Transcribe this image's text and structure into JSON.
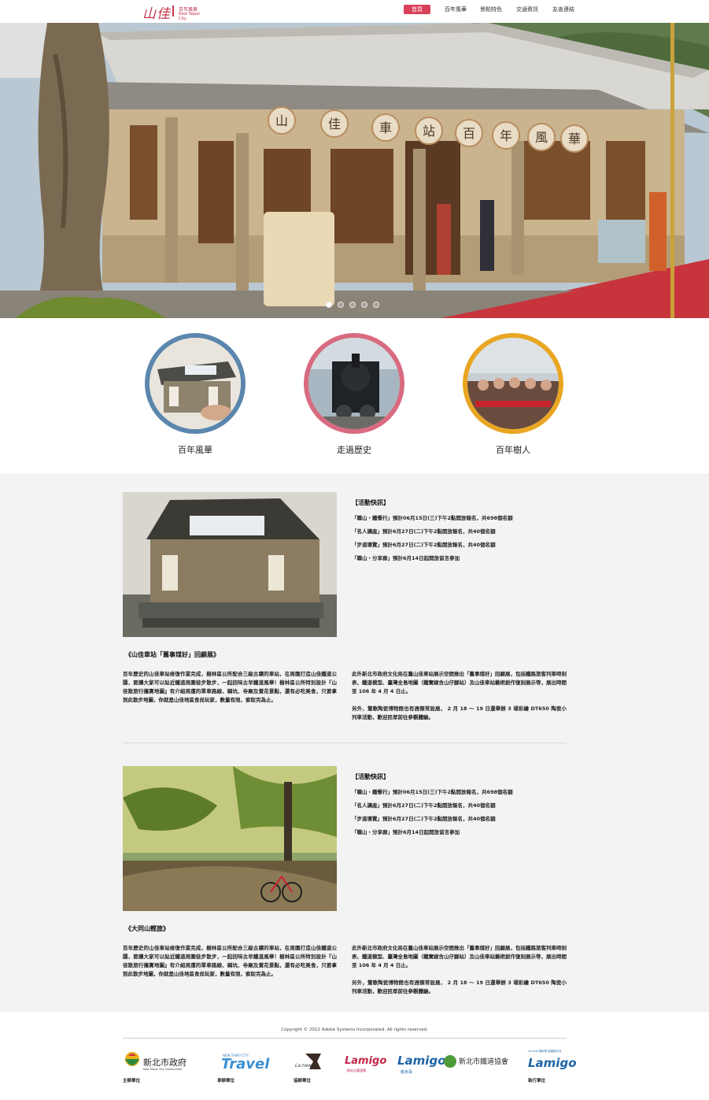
{
  "header": {
    "logo": {
      "main": "山佳",
      "sub1": "百年風華",
      "sub2": "New Taipei City"
    },
    "nav": [
      "首頁",
      "百年風華",
      "景點特色",
      "交通資訊",
      "友善連結"
    ],
    "active_index": 0,
    "accent_color": "#d9415a"
  },
  "hero": {
    "banner_text": [
      "山",
      "佳",
      "車",
      "站",
      "百",
      "年",
      "風",
      "華"
    ],
    "slides": 5,
    "active_slide": 0
  },
  "features": [
    {
      "label": "百年風華",
      "ring_color": "#5b86ad"
    },
    {
      "label": "走過歷史",
      "ring_color": "#d86b80"
    },
    {
      "label": "百年樹人",
      "ring_color": "#e9a622"
    }
  ],
  "articles": [
    {
      "news_title": "【活動快訊】",
      "news": [
        "「職山・鐵餐行」預計06月15日(三)下午2點開放報名，共698個名額",
        "「名人講座」預計6月27日(二)下午2點開放報名，共40個名額",
        "「步道導覽」預計6月27日(二)下午2點開放報名，共40個名額",
        "「職山・分享廊」預計6月14日起開放留言參加"
      ],
      "title": "《山佳車站「舊事煤好」回顧展》",
      "left_para": "百年歷史的山佳車站修復作業完成，樹林區公所配合三級古蹟的車站，在周圍打造山佳鐵道公園，要讓大家可以貼近鐵道周圍徒步散步，一起回味古早鐵道風華！樹林區公所特別設計『山佳散旅行攜寶地圖』有介紹周遭的單車路線、碉坑、寺廟及賞花景點，還有必吃美食，只要拿到此散步地圖，你就是山佳地區食尚玩家，數量有限，索取完為止。",
      "right_para1": "此外新北市政府文化局在舊山佳車站展示空間推出「舊事煤好」回顧展，包括鐵路旅客列車時刻表、鐵道模型、臺灣全島地圖（鐵實線含山仔腳站）及山佳車站藝術創作復刻展示等，展出時間至 106 年 4 月 4 日止。",
      "right_para2": "另外，鶯歌陶瓷博物館也有週傑常設展， 2 月 18 ～ 19 日還舉辦 3 場彩繪 DT650 陶瓷小列車活動，歡迎民眾前往參觀體驗。"
    },
    {
      "news_title": "【活動快訊】",
      "news": [
        "「職山・鐵餐行」預計06月15日(三)下午2點開放報名，共698個名額",
        "「名人講座」預計6月27日(二)下午2點開放報名，共40個名額",
        "「步道導覽」預計6月27日(二)下午2點開放報名，共40個名額",
        "「職山・分享廊」預計6月14日起開放留言參加"
      ],
      "title": "《大同山輕旅》",
      "left_para": "百年歷史的山佳車站修復作業完成，樹林區公所配合三級古蹟的車站，在周圍打造山佳鐵道公園，要讓大家可以貼近鐵道周圍徒步散步，一起回味古早鐵道風華！樹林區公所特別設計『山佳散旅行攜寶地圖』有介紹周遭的單車路線、碉坑、寺廟及賞花景點，還有必吃美食，只要拿到此散步地圖，你就是山佳地區食尚玩家，數量有限，索取完為止。",
      "right_para1": "此外新北市政府文化局在舊山佳車站展示空間推出「舊事煤好」回顧展，包括鐵路旅客列車時刻表、鐵道模型、臺灣全島地圖（鐵實線含山仔腳站）及山佳車站藝術創作復刻展示等，展出時間至 106 年 4 月 4 日止。",
      "right_para2": "另外，鶯歌陶瓷博物館也有週傑常設展， 2 月 18 ～ 19 日還舉辦 3 場彩繪 DT650 陶瓷小列車活動，歡迎民眾前往參觀體驗。"
    }
  ],
  "footer": {
    "copyright": "Copyright © 2012 Adobe Systems Incorporated. All rights reserved.",
    "sponsors": [
      {
        "name": "新北市政府",
        "sub": "New Taipei City Government"
      },
      {
        "name": "Travel",
        "sub": "NEW TAIPEI CITY"
      },
      {
        "name": "La new",
        "sub": ""
      },
      {
        "name": "Lamigo",
        "sub": "桃米吉應援團"
      },
      {
        "name": "Lamigo",
        "sub": "桃米哥"
      },
      {
        "name": "新北市鐵道協會",
        "sub": ""
      },
      {
        "name": "Lamigo",
        "sub": "La new 桃米哥 旅遊旅行社"
      }
    ],
    "labels": [
      "主辦單位",
      "承辦單位",
      "協辦單位",
      "執行單位"
    ]
  }
}
